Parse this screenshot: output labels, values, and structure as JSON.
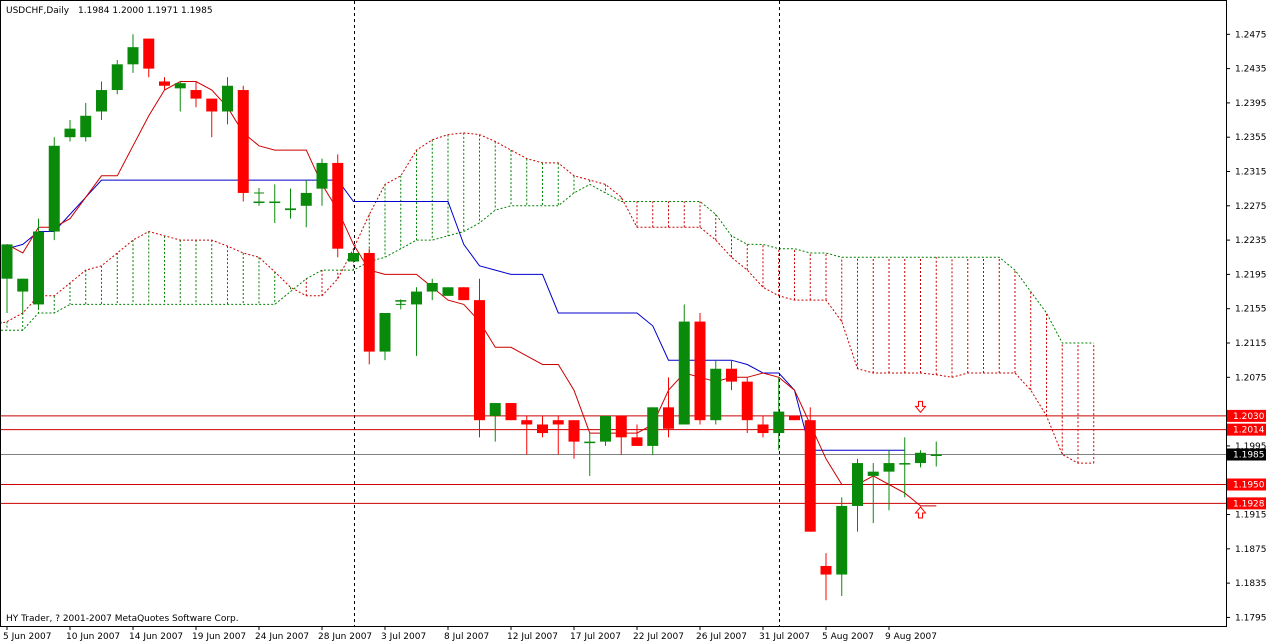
{
  "header": {
    "symbol": "USDCHF,Daily",
    "ohlc": "1.1984 1.2000 1.1971 1.1985"
  },
  "footer": {
    "copyright": "HY Trader, ? 2001-2007 MetaQuotes Software Corp."
  },
  "colors": {
    "bull": "#0a8a0a",
    "bear": "#ff0000",
    "kijun": "#0000cc",
    "tenkan": "#cc0000",
    "cloud_red": "#cc0000",
    "cloud_green": "#008000",
    "hline": "#cc0000",
    "current": "#808080"
  },
  "chart_data": {
    "type": "candlestick",
    "title": "USDCHF,Daily",
    "ylim": [
      1.1785,
      1.2515
    ],
    "y_ticks": [
      "1.2475",
      "1.2435",
      "1.2395",
      "1.2355",
      "1.2315",
      "1.2275",
      "1.2235",
      "1.2195",
      "1.2155",
      "1.2115",
      "1.2075",
      "1.1995",
      "1.1915",
      "1.1875",
      "1.1835",
      "1.1795"
    ],
    "x_ticks": [
      {
        "i": 0,
        "label": "5 Jun 2007"
      },
      {
        "i": 4,
        "label": "10 Jun 2007"
      },
      {
        "i": 8,
        "label": "14 Jun 2007"
      },
      {
        "i": 12,
        "label": "19 Jun 2007"
      },
      {
        "i": 16,
        "label": "24 Jun 2007"
      },
      {
        "i": 20,
        "label": "28 Jun 2007"
      },
      {
        "i": 24,
        "label": "3 Jul 2007"
      },
      {
        "i": 28,
        "label": "8 Jul 2007"
      },
      {
        "i": 32,
        "label": "12 Jul 2007"
      },
      {
        "i": 36,
        "label": "17 Jul 2007"
      },
      {
        "i": 40,
        "label": "22 Jul 2007"
      },
      {
        "i": 44,
        "label": "26 Jul 2007"
      },
      {
        "i": 48,
        "label": "31 Jul 2007"
      },
      {
        "i": 52,
        "label": "5 Aug 2007"
      },
      {
        "i": 56,
        "label": "9 Aug 2007"
      }
    ],
    "period_separators": [
      22,
      49
    ],
    "candles": [
      [
        1.219,
        1.223,
        1.215,
        1.223
      ],
      [
        1.2175,
        1.219,
        1.215,
        1.219
      ],
      [
        1.216,
        1.226,
        1.2155,
        1.2245
      ],
      [
        1.2245,
        1.2355,
        1.2235,
        1.2345
      ],
      [
        1.2355,
        1.2375,
        1.235,
        1.2365
      ],
      [
        1.2355,
        1.2395,
        1.235,
        1.238
      ],
      [
        1.2385,
        1.242,
        1.2375,
        1.241
      ],
      [
        1.241,
        1.2445,
        1.2405,
        1.244
      ],
      [
        1.244,
        1.2475,
        1.243,
        1.246
      ],
      [
        1.247,
        1.247,
        1.2425,
        1.2435
      ],
      [
        1.242,
        1.2425,
        1.241,
        1.2415
      ],
      [
        1.2412,
        1.242,
        1.2385,
        1.2418
      ],
      [
        1.241,
        1.242,
        1.239,
        1.24
      ],
      [
        1.24,
        1.24,
        1.2355,
        1.2385
      ],
      [
        1.2385,
        1.2425,
        1.237,
        1.2415
      ],
      [
        1.241,
        1.2415,
        1.228,
        1.229
      ],
      [
        1.228,
        1.229,
        1.2275,
        1.228
      ],
      [
        1.228,
        1.23,
        1.2255,
        1.228
      ],
      [
        1.227,
        1.2295,
        1.226,
        1.2272
      ],
      [
        1.2275,
        1.2305,
        1.225,
        1.229
      ],
      [
        1.2295,
        1.233,
        1.2275,
        1.2325
      ],
      [
        1.2325,
        1.2335,
        1.2215,
        1.2225
      ],
      [
        1.221,
        1.2225,
        1.221,
        1.222
      ],
      [
        1.222,
        1.2225,
        1.209,
        1.2105
      ],
      [
        1.2105,
        1.2145,
        1.2095,
        1.215
      ],
      [
        1.2165,
        1.2165,
        1.216,
        1.2165
      ],
      [
        1.216,
        1.218,
        1.21,
        1.2175
      ],
      [
        1.2175,
        1.219,
        1.2165,
        1.2185
      ],
      [
        1.217,
        1.218,
        1.217,
        1.218
      ],
      [
        1.218,
        1.218,
        1.2165,
        1.2165
      ],
      [
        1.2165,
        1.219,
        1.2005,
        1.2025
      ],
      [
        1.203,
        1.2045,
        1.2,
        1.2045
      ],
      [
        1.2045,
        1.2045,
        1.2025,
        1.2025
      ],
      [
        1.2025,
        1.203,
        1.1985,
        1.202
      ],
      [
        1.202,
        1.203,
        1.2005,
        1.201
      ],
      [
        1.2025,
        1.203,
        1.1985,
        1.202
      ],
      [
        1.2025,
        1.2025,
        1.198,
        1.2
      ],
      [
        1.2,
        1.201,
        1.196,
        1.2
      ],
      [
        1.2,
        1.203,
        1.1995,
        1.203
      ],
      [
        1.203,
        1.203,
        1.1985,
        1.2005
      ],
      [
        1.2005,
        1.202,
        1.1995,
        1.1995
      ],
      [
        1.1995,
        1.204,
        1.1985,
        1.204
      ],
      [
        1.204,
        1.2075,
        1.2005,
        1.2015
      ],
      [
        1.202,
        1.216,
        1.202,
        1.214
      ],
      [
        1.214,
        1.215,
        1.202,
        1.2025
      ],
      [
        1.2025,
        1.2095,
        1.202,
        1.2085
      ],
      [
        1.2085,
        1.2095,
        1.206,
        1.207
      ],
      [
        1.207,
        1.2075,
        1.201,
        1.2025
      ],
      [
        1.202,
        1.203,
        1.2005,
        1.201
      ],
      [
        1.201,
        1.2075,
        1.199,
        1.2035
      ],
      [
        1.203,
        1.203,
        1.2025,
        1.2025
      ],
      [
        1.2025,
        1.204,
        1.1895,
        1.1895
      ],
      [
        1.1855,
        1.187,
        1.1815,
        1.1845
      ],
      [
        1.1845,
        1.1935,
        1.182,
        1.1925
      ],
      [
        1.1925,
        1.198,
        1.1895,
        1.1975
      ],
      [
        1.196,
        1.1975,
        1.1905,
        1.1965
      ],
      [
        1.1965,
        1.199,
        1.192,
        1.1975
      ],
      [
        1.1974,
        1.2005,
        1.1935,
        1.1975
      ],
      [
        1.1975,
        1.199,
        1.197,
        1.1987
      ],
      [
        1.1984,
        1.2,
        1.1971,
        1.1985
      ]
    ],
    "tenkan_sen": [
      1.223,
      1.222,
      1.225,
      1.225,
      1.226,
      1.2285,
      1.231,
      1.231,
      1.2345,
      1.238,
      1.241,
      1.242,
      1.242,
      1.241,
      1.239,
      1.236,
      1.2345,
      1.234,
      1.234,
      1.234,
      1.23,
      1.227,
      1.223,
      1.22,
      1.2195,
      1.2195,
      1.2195,
      1.218,
      1.2165,
      1.216,
      1.214,
      1.211,
      1.211,
      1.21,
      1.209,
      1.209,
      1.206,
      1.201,
      1.201,
      1.201,
      1.201,
      1.202,
      1.206,
      1.208,
      1.2075,
      1.207,
      1.2075,
      1.2075,
      1.208,
      1.2075,
      1.206,
      1.202,
      1.198,
      1.195,
      1.195,
      1.196,
      1.195,
      1.194,
      1.1925,
      1.1925
    ],
    "kijun_sen": [
      1.2225,
      1.223,
      1.2245,
      1.2245,
      1.2265,
      1.2285,
      1.2305,
      1.2305,
      1.2305,
      1.2305,
      1.2305,
      1.2305,
      1.2305,
      1.2305,
      1.2305,
      1.2305,
      1.2305,
      1.2305,
      1.2305,
      1.2305,
      1.2305,
      1.2305,
      1.228,
      1.228,
      1.228,
      1.228,
      1.228,
      1.228,
      1.228,
      1.223,
      1.2205,
      1.22,
      1.2195,
      1.2195,
      1.2195,
      1.215,
      1.215,
      1.215,
      1.215,
      1.215,
      1.215,
      1.2135,
      1.2095,
      1.2095,
      1.2095,
      1.2095,
      1.2095,
      1.209,
      1.208,
      1.208,
      1.206,
      1.199,
      1.199,
      1.199,
      1.199,
      1.199,
      1.199,
      1.199
    ],
    "senkou_a": [
      1.214,
      1.214,
      1.214,
      1.2138,
      1.2138,
      1.214,
      1.215,
      1.217,
      1.217,
      1.2185,
      1.22,
      1.2205,
      1.222,
      1.2235,
      1.2245,
      1.224,
      1.2235,
      1.2235,
      1.2235,
      1.2228,
      1.222,
      1.2215,
      1.2198,
      1.218,
      1.217,
      1.217,
      1.219,
      1.2225,
      1.2265,
      1.23,
      1.231,
      1.234,
      1.2352,
      1.2358,
      1.236,
      1.2358,
      1.235,
      1.234,
      1.233,
      1.2325,
      1.2325,
      1.231,
      1.2305,
      1.23,
      1.2285,
      1.225,
      1.225,
      1.225,
      1.225,
      1.225,
      1.2235,
      1.2215,
      1.22,
      1.218,
      1.217,
      1.2165,
      1.2165,
      1.2165,
      1.214,
      1.2085,
      1.208,
      1.208,
      1.208,
      1.208,
      1.2078,
      1.2075,
      1.208,
      1.208,
      1.208,
      1.208,
      1.206,
      1.203,
      1.1985,
      1.1975,
      1.1975
    ],
    "senkou_b": [
      1.213,
      1.213,
      1.213,
      1.213,
      1.213,
      1.213,
      1.213,
      1.215,
      1.215,
      1.216,
      1.216,
      1.216,
      1.216,
      1.216,
      1.216,
      1.216,
      1.216,
      1.216,
      1.216,
      1.216,
      1.216,
      1.216,
      1.216,
      1.2175,
      1.219,
      1.22,
      1.22,
      1.22,
      1.221,
      1.2215,
      1.2225,
      1.2235,
      1.2235,
      1.224,
      1.2245,
      1.2255,
      1.227,
      1.2275,
      1.2275,
      1.2275,
      1.2275,
      1.229,
      1.23,
      1.229,
      1.228,
      1.228,
      1.228,
      1.228,
      1.228,
      1.228,
      1.2265,
      1.224,
      1.223,
      1.223,
      1.2225,
      1.2225,
      1.222,
      1.222,
      1.2215,
      1.2215,
      1.2215,
      1.2215,
      1.2215,
      1.2215,
      1.2215,
      1.2215,
      1.2215,
      1.2215,
      1.2215,
      1.22,
      1.2175,
      1.215,
      1.2115,
      1.2115,
      1.2115
    ],
    "cloud_shift": 5,
    "hlines": [
      {
        "price": 1.203,
        "label": "1.2030"
      },
      {
        "price": 1.2014,
        "label": "1.2014"
      },
      {
        "price": 1.195,
        "label": "1.1950"
      },
      {
        "price": 1.1928,
        "label": "1.1928"
      }
    ],
    "current_price": {
      "price": 1.1985,
      "label": "1.1985"
    },
    "arrows": [
      {
        "i": 58,
        "price": 1.204,
        "dir": "down"
      },
      {
        "i": 58,
        "price": 1.1918,
        "dir": "up"
      }
    ],
    "crosses": [
      {
        "i": 16,
        "price": 1.229
      },
      {
        "i": 25,
        "price": 1.216
      }
    ]
  }
}
